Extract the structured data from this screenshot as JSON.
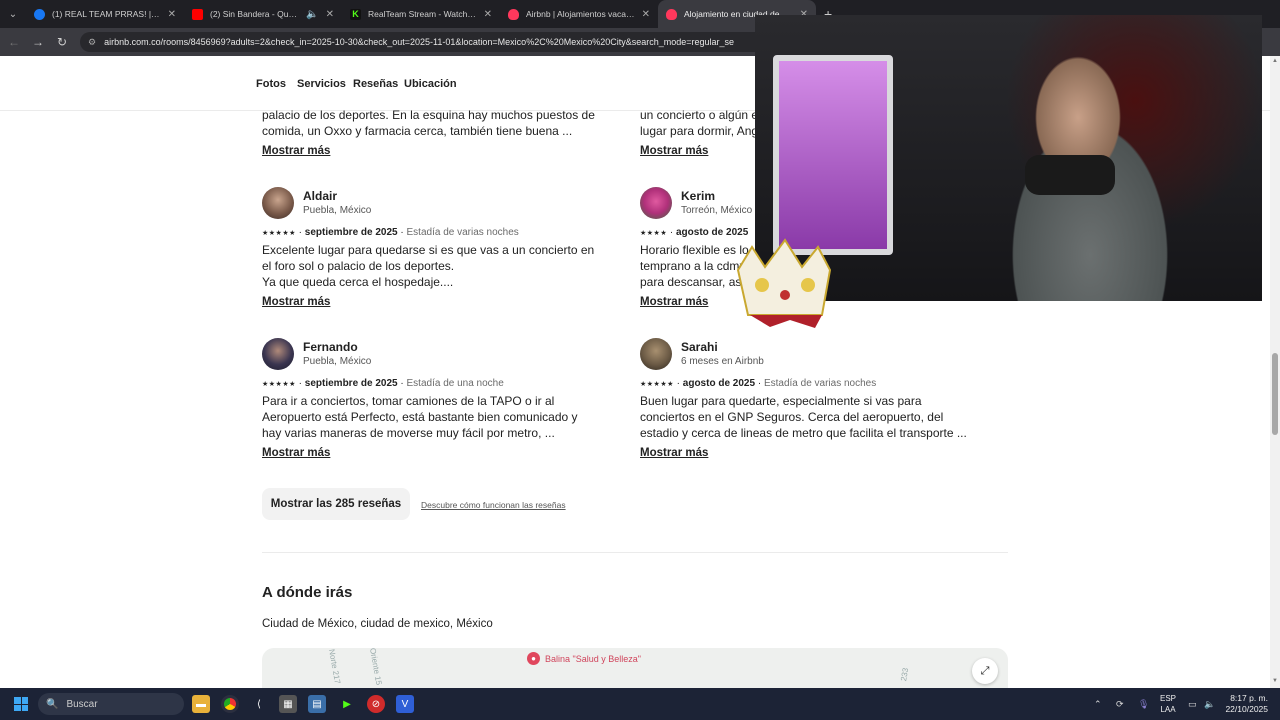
{
  "browser": {
    "tabs": [
      {
        "title": "(1) REAL TEAM PRRAS! | Facebo",
        "color": "#1877f2",
        "active": false
      },
      {
        "title": "(2) Sin Bandera - Que Lloro",
        "color": "#ff0000",
        "active": false
      },
      {
        "title": "RealTeam Stream - Watch Live",
        "color": "#53fc18",
        "active": false
      },
      {
        "title": "Airbnb | Alojamientos vacacio",
        "color": "#ff385c",
        "active": false
      },
      {
        "title": "Alojamiento en ciudad de Mex",
        "color": "#ff385c",
        "active": true
      }
    ],
    "new_tab": "+",
    "url": "airbnb.com.co/rooms/8456969?adults=2&check_in=2025-10-30&check_out=2025-11-01&location=Mexico%2C%20Mexico%20City&search_mode=regular_se"
  },
  "subnav": {
    "fotos": "Fotos",
    "servicios": "Servicios",
    "resenas": "Reseñas",
    "ubicacion": "Ubicación"
  },
  "top_left_snippet": {
    "line1": "palacio de los deportes. En la esquina hay muchos puestos de",
    "line2": "comida, un Oxxo y farmacia cerca, también tiene buena ...",
    "more": "Mostrar más"
  },
  "top_right_snippet": {
    "line1": "un concierto o algún ev",
    "line2": "lugar para dormir, Ange",
    "more": "Mostrar más"
  },
  "reviews": [
    {
      "name": "Aldair",
      "location": "Puebla, México",
      "stars": "★★★★★",
      "date": "septiembre de 2025",
      "stay": "Estadía de varias noches",
      "lines": [
        "Excelente lugar para quedarse si es que vas a un concierto en",
        "el foro sol o palacio de los deportes.",
        "Ya que queda cerca el hospedaje...."
      ],
      "more": "Mostrar más",
      "avatar_color": "#7a5a4a"
    },
    {
      "name": "Kerim",
      "location": "Torreón, México",
      "stars": "★★★★",
      "date": "agosto de 2025",
      "stay": "",
      "lines": [
        "Horario flexible es lo",
        "temprano a la cdmx",
        "para descansar, así q"
      ],
      "more": "Mostrar más",
      "avatar_color": "#b0307a"
    },
    {
      "name": "Fernando",
      "location": "Puebla, México",
      "stars": "★★★★★",
      "date": "septiembre de 2025",
      "stay": "Estadía de una noche",
      "lines": [
        "Para ir a conciertos, tomar camiones de la TAPO o ir al",
        "Aeropuerto está Perfecto, está bastante bien comunicado y",
        "hay varias maneras de moverse muy fácil por metro, ..."
      ],
      "more": "Mostrar más",
      "avatar_color": "#3a3550"
    },
    {
      "name": "Sarahi",
      "location": "6 meses en Airbnb",
      "stars": "★★★★★",
      "date": "agosto de 2025",
      "stay": "Estadía de varias noches",
      "lines": [
        "Buen lugar para quedarte, especialmente si vas para",
        "conciertos en el GNP Seguros. Cerca del aeropuerto, del",
        "estadio y cerca de lineas de metro que facilita el transporte ..."
      ],
      "more": "Mostrar más",
      "avatar_color": "#6b5a45"
    }
  ],
  "show_all_reviews": "Mostrar las 285 reseñas",
  "how_reviews_work": "Descubre cómo funcionan las reseñas",
  "where_title": "A dónde irás",
  "where_place": "Ciudad de México, ciudad de mexico, México",
  "map": {
    "poi": "Balina \"Salud y Belleza\"",
    "road1": "Norte 217",
    "road2": "Oriente 15",
    "road3": "233"
  },
  "taskbar": {
    "search_placeholder": "Buscar",
    "lang_line1": "ESP",
    "lang_line2": "LAA",
    "time": "8:17 p. m.",
    "date": "22/10/2025"
  }
}
